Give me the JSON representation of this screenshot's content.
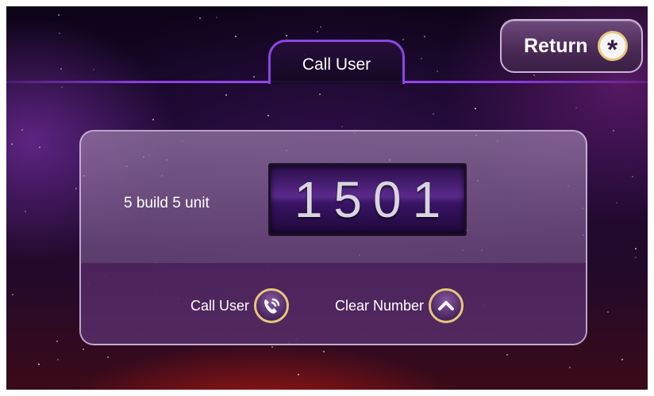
{
  "header": {
    "tab_label": "Call User"
  },
  "return_button": {
    "label": "Return",
    "icon": "asterisk-icon",
    "icon_glyph": "*"
  },
  "panel": {
    "location_text": "5 build 5 unit",
    "number_display": "1501",
    "actions": [
      {
        "label": "Call User",
        "icon": "phone-icon"
      },
      {
        "label": "Clear Number",
        "icon": "chevron-up-icon"
      }
    ]
  },
  "colors": {
    "accent_purple": "#8d44e6",
    "gold_ring": "#e6c67b",
    "display_purple": "#5a2a8c"
  }
}
